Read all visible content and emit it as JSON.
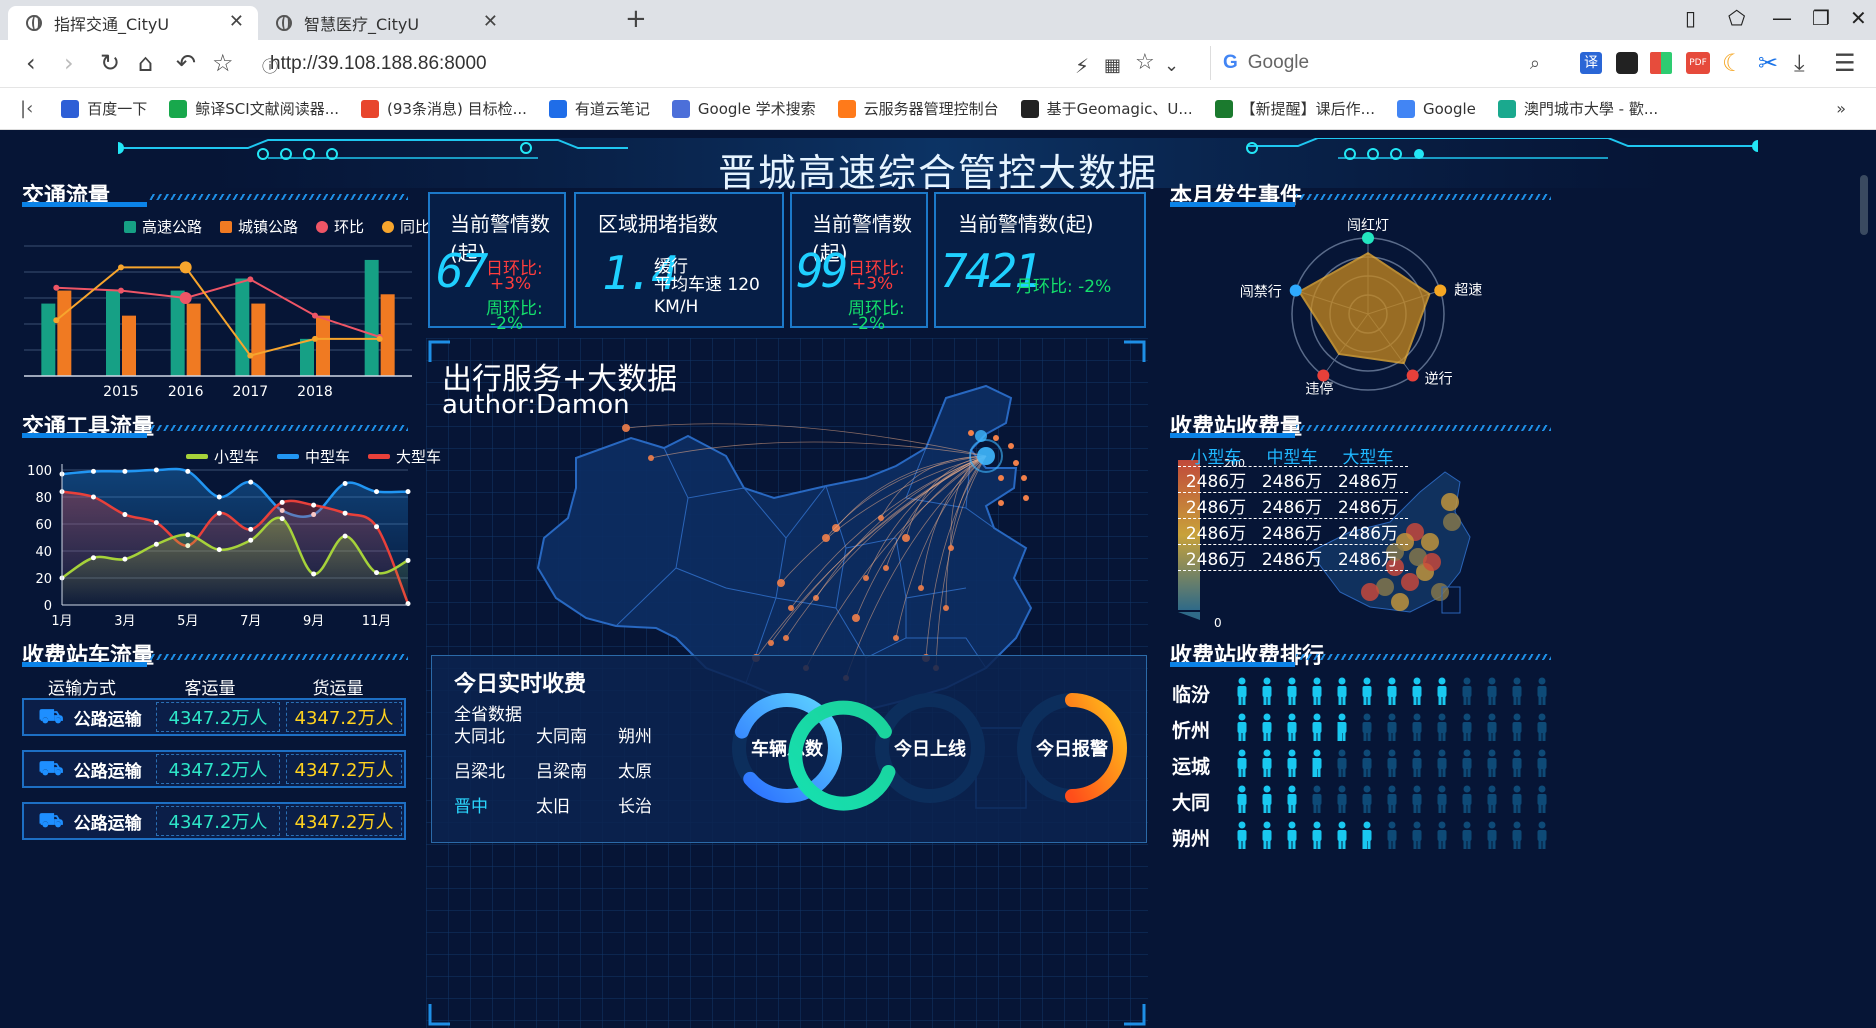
{
  "browser": {
    "tabs": [
      {
        "title": "指挥交通_CityU",
        "active": true
      },
      {
        "title": "智慧医疗_CityU",
        "active": false
      }
    ],
    "url": "http://39.108.188.86:8000",
    "search_engine": "Google",
    "bookmarks": [
      "百度一下",
      "鲸译SCI文献阅读器...",
      "(93条消息) 目标检...",
      "有道云笔记",
      "Google 学术搜索",
      "云服务器管理控制台",
      "基于Geomagic、U...",
      "【新提醒】课后作...",
      "Google",
      "澳門城市大學 - 歡..."
    ],
    "bookmark_colors": [
      "#2e5fd6",
      "#18a84c",
      "#e8452c",
      "#1f6de8",
      "#4c6fd9",
      "#ff7a1a",
      "#222222",
      "#1b7a2e",
      "#4285f4",
      "#1aa98e"
    ]
  },
  "dashboard": {
    "title": "晋城高速综合管控大数据",
    "traffic_flow": {
      "title": "交通流量",
      "legend": [
        "高速公路",
        "城镇公路",
        "环比",
        "同比"
      ],
      "colors": [
        "#16a085",
        "#f07a22",
        "#ee5566",
        "#f7a52d"
      ]
    },
    "vehicle_flow": {
      "title": "交通工具流量",
      "legend": [
        "小型车",
        "中型车",
        "大型车"
      ],
      "colors": [
        "#a6d23a",
        "#2196f3",
        "#e8403a"
      ]
    },
    "toll_station_flow": {
      "title": "收费站车流量",
      "headers": [
        "运输方式",
        "客运量",
        "货运量"
      ],
      "rows": [
        {
          "mode": "公路运输",
          "passenger": "4347.2万人",
          "freight": "4347.2万人"
        },
        {
          "mode": "公路运输",
          "passenger": "4347.2万人",
          "freight": "4347.2万人"
        },
        {
          "mode": "公路运输",
          "passenger": "4347.2万人",
          "freight": "4347.2万人"
        }
      ]
    },
    "cards": [
      {
        "title": "当前警情数(起)",
        "value": "67",
        "day_label": "日环比:",
        "day_value": "+3%",
        "week_label": "周环比:",
        "week_value": "-2%"
      },
      {
        "title": "区域拥堵指数",
        "value": "1.4",
        "status": "缓行",
        "speed": "平均车速 120 KM/H"
      },
      {
        "title": "当前警情数(起)",
        "value": "99",
        "day_label": "日环比:",
        "day_value": "+3%",
        "week_label": "周环比:",
        "week_value": "-2%"
      },
      {
        "title": "当前警情数(起)",
        "value": "7421",
        "month_label": "月环比: -2%"
      }
    ],
    "map": {
      "title": "出行服务+大数据",
      "author": "author:Damon"
    },
    "realtime_fee": {
      "title": "今日实时收费",
      "subtitle": "全省数据",
      "stations": [
        "大同北",
        "大同南",
        "朔州",
        "吕梁北",
        "吕梁南",
        "太原",
        "晋中",
        "太旧",
        "长治"
      ],
      "rings": [
        "车辆总数",
        "今日上线",
        "今日报警"
      ]
    },
    "events": {
      "title": "本月发生事件",
      "axes": [
        "闯红灯",
        "超速",
        "逆行",
        "违停",
        "闯禁行"
      ]
    },
    "toll_income": {
      "title": "收费站收费量",
      "headers": [
        "小型车",
        "中型车",
        "大型车"
      ],
      "rows": [
        [
          "2486万",
          "2486万",
          "2486万"
        ],
        [
          "2486万",
          "2486万",
          "2486万"
        ],
        [
          "2486万",
          "2486万",
          "2486万"
        ],
        [
          "2486万",
          "2486万",
          "2486万"
        ]
      ],
      "scale_max": "200",
      "scale_min": "0"
    },
    "toll_rank": {
      "title": "收费站收费排行",
      "cities": [
        "临汾",
        "忻州",
        "运城",
        "大同",
        "朔州"
      ],
      "filled_counts": [
        9,
        4.5,
        3.5,
        3,
        5.5
      ],
      "total_icons": 13
    }
  },
  "chart_data": [
    {
      "type": "bar",
      "categories": [
        "",
        "2015",
        "2016",
        "2017",
        "2018",
        ""
      ],
      "series": [
        {
          "name": "高速公路",
          "type": "bar",
          "values": [
            78,
            92,
            92,
            105,
            40,
            125
          ]
        },
        {
          "name": "城镇公路",
          "type": "bar",
          "values": [
            92,
            65,
            78,
            78,
            65,
            88
          ]
        },
        {
          "name": "环比",
          "type": "line",
          "values": [
            95,
            92,
            84,
            104,
            65,
            42
          ]
        },
        {
          "name": "同比",
          "type": "line",
          "values": [
            60,
            117,
            117,
            22,
            40,
            40
          ]
        }
      ],
      "ylim": [
        0,
        140
      ]
    },
    {
      "type": "line",
      "categories": [
        "1月",
        "2月",
        "3月",
        "4月",
        "5月",
        "6月",
        "7月",
        "8月",
        "9月",
        "10月",
        "11月",
        "12月"
      ],
      "x_tick_labels": [
        "1月",
        "3月",
        "5月",
        "7月",
        "9月",
        "11月"
      ],
      "series": [
        {
          "name": "小型车",
          "values": [
            20,
            35,
            34,
            45,
            52,
            41,
            48,
            64,
            23,
            51,
            24,
            33
          ]
        },
        {
          "name": "中型车",
          "values": [
            97,
            99,
            99,
            100,
            99,
            80,
            91,
            70,
            67,
            90,
            84,
            84
          ]
        },
        {
          "name": "大型车",
          "values": [
            84,
            80,
            67,
            61,
            44,
            68,
            56,
            76,
            74,
            68,
            58,
            1
          ]
        }
      ],
      "yticks": [
        0,
        20,
        40,
        60,
        80,
        100
      ],
      "ylim": [
        0,
        100
      ]
    },
    {
      "type": "radar",
      "axes": [
        "闯红灯",
        "超速",
        "逆行",
        "违停",
        "闯禁行"
      ],
      "max": 100,
      "series": [
        {
          "values": [
            80,
            85,
            80,
            65,
            95
          ]
        }
      ]
    }
  ]
}
